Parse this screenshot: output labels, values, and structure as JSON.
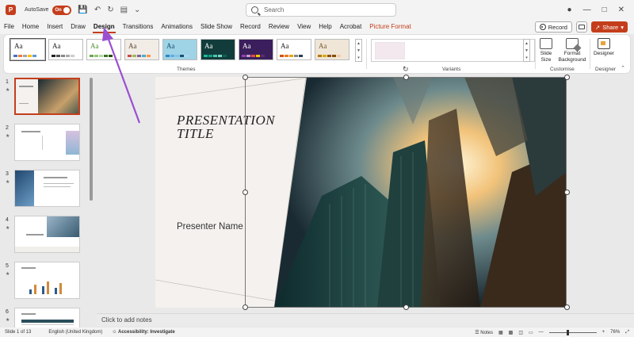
{
  "titlebar": {
    "autosave_label": "AutoSave",
    "autosave_state": "On",
    "search_placeholder": "Search"
  },
  "tabs": [
    {
      "label": "File",
      "active": false
    },
    {
      "label": "Home",
      "active": false
    },
    {
      "label": "Insert",
      "active": false
    },
    {
      "label": "Draw",
      "active": false
    },
    {
      "label": "Design",
      "active": true
    },
    {
      "label": "Transitions",
      "active": false
    },
    {
      "label": "Animations",
      "active": false
    },
    {
      "label": "Slide Show",
      "active": false
    },
    {
      "label": "Record",
      "active": false
    },
    {
      "label": "Review",
      "active": false
    },
    {
      "label": "View",
      "active": false
    },
    {
      "label": "Help",
      "active": false
    },
    {
      "label": "Acrobat",
      "active": false
    },
    {
      "label": "Picture Format",
      "active": false,
      "contextual": true
    }
  ],
  "toolbar": {
    "record_label": "Record",
    "share_label": "Share"
  },
  "ribbon": {
    "themes_label": "Themes",
    "variants_label": "Variants",
    "customise_label": "Customise",
    "designer_group_label": "Designer",
    "slide_size_label": "Slide Size",
    "format_background_label": "Format Background",
    "designer_label": "Designer",
    "theme_sample_text": "Aa",
    "themes": [
      {
        "bg": "#ffffff",
        "fg": "#222222",
        "swatches": [
          "#4472c4",
          "#ed7d31",
          "#a5a5a5",
          "#ffc000",
          "#5b9bd5"
        ]
      },
      {
        "bg": "#ffffff",
        "fg": "#222222",
        "swatches": [
          "#222222",
          "#555555",
          "#888888",
          "#aaaaaa",
          "#cccccc"
        ]
      },
      {
        "bg": "#ffffff",
        "fg": "#4e8f2a",
        "swatches": [
          "#6aa84f",
          "#93c47d",
          "#b6d7a8",
          "#38761d",
          "#274e13"
        ]
      },
      {
        "bg": "#f2ece6",
        "fg": "#5a4634",
        "swatches": [
          "#c0504d",
          "#9bbb59",
          "#8064a2",
          "#4bacc6",
          "#f79646"
        ]
      },
      {
        "bg": "#9fd3e6",
        "fg": "#1b4f72",
        "swatches": [
          "#2e86c1",
          "#5dade2",
          "#85c1e9",
          "#1b4f72",
          "#aed6f1"
        ]
      },
      {
        "bg": "#123c3c",
        "fg": "#ffffff",
        "swatches": [
          "#1abc9c",
          "#16a085",
          "#48c9b0",
          "#76d7c4",
          "#0e6251"
        ]
      },
      {
        "bg": "#3b1f5c",
        "fg": "#ffffff",
        "swatches": [
          "#8e44ad",
          "#c39bd3",
          "#e74c3c",
          "#f1c40f",
          "#5b2c6f"
        ]
      },
      {
        "bg": "#ffffff",
        "fg": "#222222",
        "swatches": [
          "#d35400",
          "#e67e22",
          "#f39c12",
          "#7f8c8d",
          "#2c3e50"
        ]
      },
      {
        "bg": "#efe6d8",
        "fg": "#7a5a2e",
        "swatches": [
          "#b9770e",
          "#d4ac0d",
          "#935116",
          "#7e5109",
          "#f5cba7"
        ]
      }
    ]
  },
  "slides_panel": {
    "slides": [
      {
        "number": "1",
        "starred": true,
        "active": true
      },
      {
        "number": "2",
        "starred": true,
        "active": false
      },
      {
        "number": "3",
        "starred": true,
        "active": false
      },
      {
        "number": "4",
        "starred": true,
        "active": false
      },
      {
        "number": "5",
        "starred": true,
        "active": false
      },
      {
        "number": "6",
        "starred": true,
        "active": false
      }
    ]
  },
  "slide": {
    "title_line1": "PRESENTATION",
    "title_line2": "TITLE",
    "presenter": "Presenter Name"
  },
  "notes_placeholder": "Click to add notes",
  "statusbar": {
    "slide_count": "Slide 1 of 13",
    "language": "English (United Kingdom)",
    "accessibility": "Accessibility: Investigate",
    "notes_label": "Notes",
    "zoom": "76%",
    "zoom_fraction": 0.38
  },
  "colors": {
    "accent": "#c43e1c",
    "annotation": "#9b4fd1"
  },
  "icons": {
    "app": "powerpoint-icon",
    "search": "search-icon",
    "record": "record-icon",
    "comments": "comment-icon",
    "share": "share-icon"
  }
}
